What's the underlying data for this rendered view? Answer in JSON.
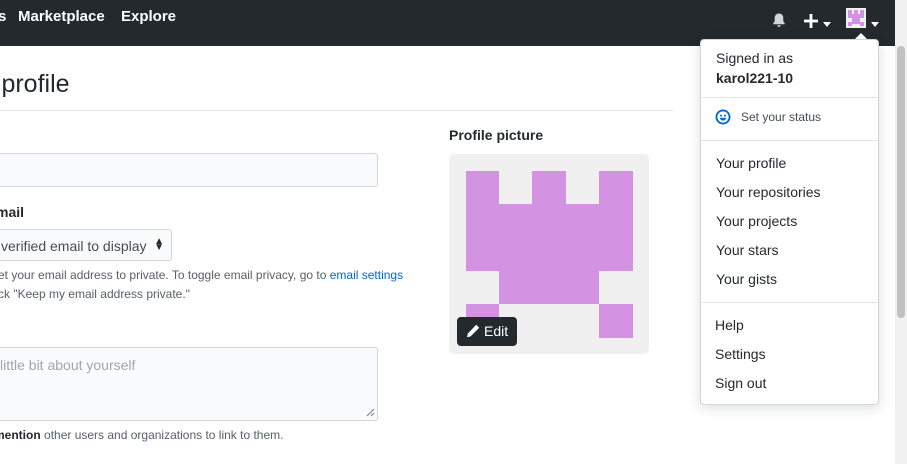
{
  "header": {
    "nav": [
      {
        "label": "s"
      },
      {
        "label": "Marketplace"
      },
      {
        "label": "Explore"
      }
    ],
    "icons": [
      "bell-icon",
      "plus-icon",
      "chevron-down-icon",
      "avatar",
      "chevron-down-icon"
    ]
  },
  "page": {
    "title": "c profile",
    "email_label": "mail",
    "email_select_value": "verified email to display",
    "email_note_line1": "et your email address to private. To toggle email privacy, go to",
    "email_note_link": "email settings",
    "email_note_line2": "ck \"Keep my email address private.\"",
    "bio_placeholder": "little bit about yourself",
    "mention_bold": "mention",
    "mention_rest": "other users and organizations to link to them."
  },
  "profile_picture": {
    "label": "Profile picture",
    "edit_label": "Edit",
    "color": "#d493e2"
  },
  "user_menu": {
    "signed_in_as": "Signed in as",
    "username": "karol221-10",
    "set_status": "Set your status",
    "items": [
      {
        "label": "Your profile"
      },
      {
        "label": "Your repositories"
      },
      {
        "label": "Your projects"
      },
      {
        "label": "Your stars"
      },
      {
        "label": "Your gists"
      }
    ],
    "footer_items": [
      {
        "label": "Help"
      },
      {
        "label": "Settings"
      },
      {
        "label": "Sign out"
      }
    ]
  }
}
